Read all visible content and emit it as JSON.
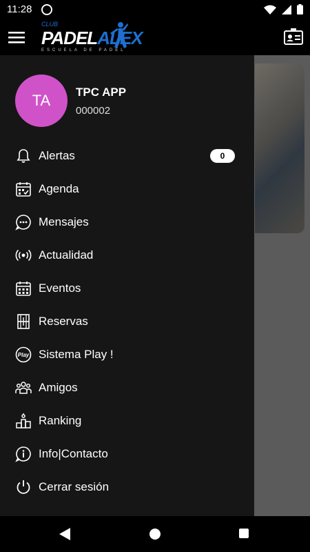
{
  "status_bar": {
    "time": "11:28"
  },
  "app_bar": {
    "logo": {
      "club": "CLUB",
      "padel": "PADEL",
      "alex": "ALEX",
      "subtitle": "ESCUELA DE PADEL"
    }
  },
  "profile": {
    "initials": "TA",
    "name": "TPC APP",
    "id": "000002",
    "avatar_color": "#d052c9"
  },
  "menu": {
    "items": [
      {
        "label": "Alertas",
        "icon": "bell-icon",
        "badge": "0"
      },
      {
        "label": "Agenda",
        "icon": "calendar-check-icon"
      },
      {
        "label": "Mensajes",
        "icon": "chat-bubble-icon"
      },
      {
        "label": "Actualidad",
        "icon": "broadcast-icon"
      },
      {
        "label": "Eventos",
        "icon": "calendar-grid-icon"
      },
      {
        "label": "Reservas",
        "icon": "court-icon"
      },
      {
        "label": "Sistema Play !",
        "icon": "play-logo-icon"
      },
      {
        "label": "Amigos",
        "icon": "group-icon"
      },
      {
        "label": "Ranking",
        "icon": "podium-icon"
      },
      {
        "label": "Info|Contacto",
        "icon": "info-icon"
      },
      {
        "label": "Cerrar sesión",
        "icon": "power-icon"
      }
    ]
  },
  "colors": {
    "accent": "#1e6fd0",
    "drawer_bg": "#161616",
    "scrim": "#5b5b5b"
  }
}
